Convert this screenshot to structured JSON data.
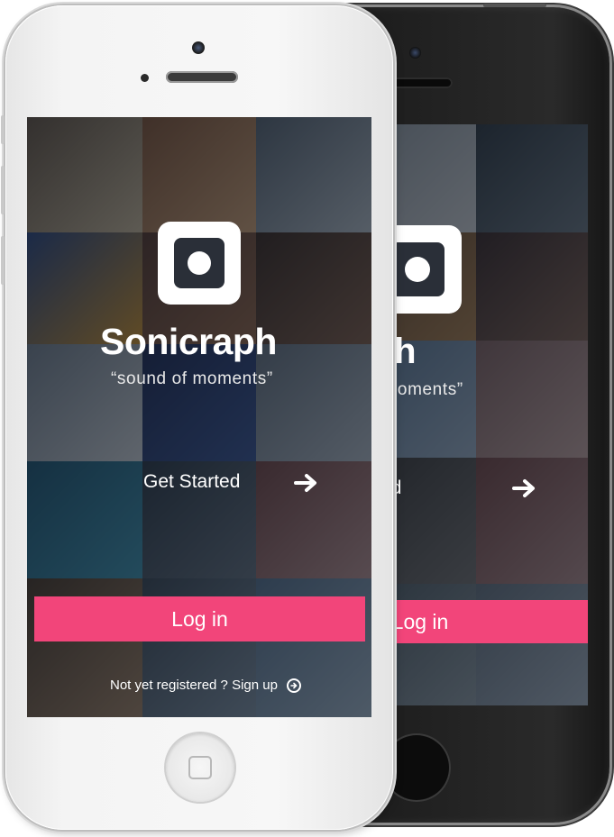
{
  "app": {
    "name": "Sonicraph",
    "tagline": "“sound of moments”",
    "logo_icon": "camera-square-icon"
  },
  "actions": {
    "get_started_label": "Get Started",
    "get_started_icon": "arrow-right-icon",
    "login_label": "Log in",
    "signup_prompt": "Not yet registered ? Sign up",
    "signup_icon": "circle-arrow-right-icon"
  },
  "colors": {
    "accent": "#f2457a",
    "front_phone_body": "#f4f4f4",
    "back_phone_body": "#1e1e1e",
    "screen_overlay": "#1b1f27"
  }
}
